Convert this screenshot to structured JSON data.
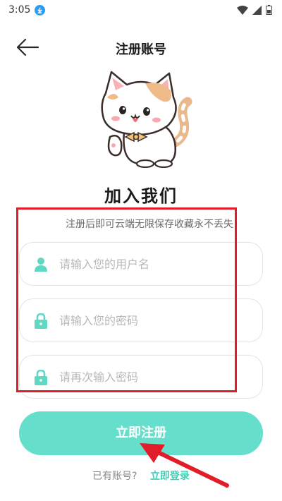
{
  "status_bar": {
    "time": "3:05",
    "icons": [
      "download-icon",
      "wifi-icon",
      "signal-icon",
      "battery-icon"
    ]
  },
  "header": {
    "title": "注册账号",
    "back_icon": "arrow-left-icon"
  },
  "hero": {
    "illustration": "cat-mascot",
    "headline": "加入我们",
    "subtitle": "注册后即可云端无限保存收藏永不丢失"
  },
  "form": {
    "username_placeholder": "请输入您的用户名",
    "password_placeholder": "请输入您的密码",
    "confirm_placeholder": "请再次输入密码",
    "username_icon": "user-icon",
    "password_icon": "lock-icon",
    "confirm_icon": "lock-icon"
  },
  "actions": {
    "register_label": "立即注册",
    "login_prompt": "已有账号?",
    "login_link": "立即登录"
  },
  "colors": {
    "accent": "#65dfcb",
    "accent_text": "#3fd1b7",
    "annotation": "#e21d2a",
    "field_icon": "#5fd8c4"
  }
}
